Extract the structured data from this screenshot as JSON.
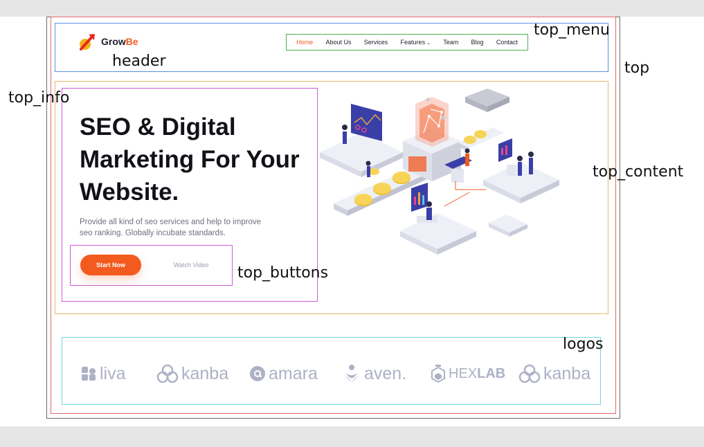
{
  "annotations": {
    "top_menu": "top_menu",
    "header": "header",
    "top": "top",
    "top_info": "top_info",
    "top_content": "top_content",
    "top_buttons": "top_buttons",
    "logos": "logos"
  },
  "brand": {
    "name_part1": "Grow",
    "name_part2": "Be",
    "icon": "rocket-arrow-logo-icon"
  },
  "menu": {
    "items": [
      "Home",
      "About Us",
      "Services",
      "Features",
      "Team",
      "Blog",
      "Contact"
    ],
    "active": "Home",
    "dropdown_item": "Features"
  },
  "hero": {
    "title_lines": [
      "SEO & Digital",
      "Marketing For Your",
      "Website."
    ],
    "description_lines": [
      "Provide all kind of seo services and help to improve",
      "seo ranking. Globally incubate standards."
    ],
    "start_button": "Start Now",
    "watch_button": "Watch Video",
    "illustration": "isometric-seo-marketing-illustration"
  },
  "logos": [
    {
      "name": "liva",
      "icon": "puzzle-icon"
    },
    {
      "name": "kanba",
      "icon": "trefoil-icon"
    },
    {
      "name": "amara",
      "icon": "at-circle-icon"
    },
    {
      "name": "aven.",
      "icon": "leaf-icon"
    },
    {
      "name_part1": "HEX",
      "name_part2": "LAB",
      "icon": "flask-hexagon-icon"
    },
    {
      "name": "kanba",
      "icon": "trefoil-icon"
    }
  ],
  "colors": {
    "accent": "#f25a1e",
    "text_dark": "#111118",
    "text_muted": "#6e6e80",
    "logo_gray": "#aeb1c6",
    "illustration_blue": "#3a3fa8",
    "coin_gold": "#f2c02e"
  }
}
